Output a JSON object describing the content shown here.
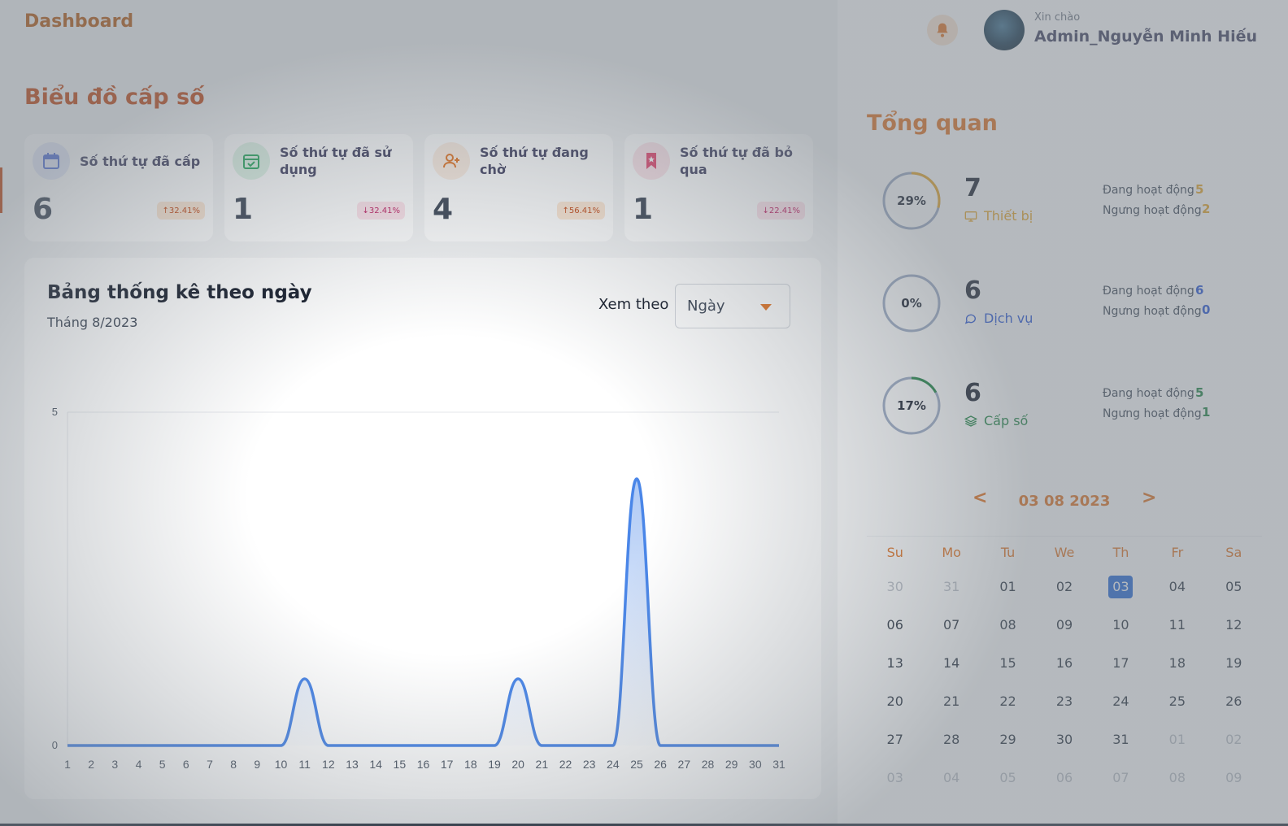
{
  "header": {
    "title": "Dashboard",
    "greeting": "Xin chào",
    "username": "Admin_Nguyễn Minh Hiếu"
  },
  "section_title": "Biểu đồ cấp số",
  "stats": [
    {
      "label": "Số thứ tự đã cấp",
      "value": "6",
      "badge": "↑32.41%",
      "trend": "up",
      "icon": "calendar-icon",
      "color": "#4f6fd8"
    },
    {
      "label": "Số thứ tự đã sử dụng",
      "value": "1",
      "badge": "↓32.41%",
      "trend": "down",
      "icon": "calendar-check-icon",
      "color": "#22a559"
    },
    {
      "label": "Số thứ tự đang chờ",
      "value": "4",
      "badge": "↑56.41%",
      "trend": "up",
      "icon": "user-add-icon",
      "color": "#e26f1b"
    },
    {
      "label": "Số thứ tự đã bỏ qua",
      "value": "1",
      "badge": "↓22.41%",
      "trend": "down",
      "icon": "bookmark-icon",
      "color": "#e2416a"
    }
  ],
  "chart_card": {
    "title": "Bảng thống kê theo ngày",
    "subtitle": "Tháng 8/2023",
    "view_label": "Xem theo",
    "view_value": "Ngày"
  },
  "chart_data": {
    "type": "area",
    "x": [
      "1",
      "2",
      "3",
      "4",
      "5",
      "6",
      "7",
      "8",
      "9",
      "10",
      "11",
      "12",
      "13",
      "14",
      "15",
      "16",
      "17",
      "18",
      "19",
      "20",
      "21",
      "22",
      "23",
      "24",
      "25",
      "26",
      "27",
      "28",
      "29",
      "30",
      "31"
    ],
    "series": [
      {
        "values": [
          0,
          0,
          0,
          0,
          0,
          0,
          0,
          0,
          0,
          0,
          1,
          0,
          0,
          0,
          0,
          0,
          0,
          0,
          0,
          1,
          0,
          0,
          0,
          0,
          4,
          0,
          0,
          0,
          0,
          0,
          0
        ]
      }
    ],
    "yticks": [
      "0",
      "5"
    ],
    "ylim": [
      0,
      5
    ],
    "color": "#4a86e8"
  },
  "overview": {
    "title": "Tổng quan",
    "active_label": "Đang hoạt động",
    "inactive_label": "Ngưng hoạt động",
    "items": [
      {
        "percent": "29%",
        "fraction": 0.29,
        "count": "7",
        "name": "Thiết bị",
        "icon": "monitor-icon",
        "active": "5",
        "inactive": "2",
        "color": "#e8a320"
      },
      {
        "percent": "0%",
        "fraction": 0.0,
        "count": "6",
        "name": "Dịch vụ",
        "icon": "chat-icon",
        "active": "6",
        "inactive": "0",
        "color": "#1d4ed8"
      },
      {
        "percent": "17%",
        "fraction": 0.17,
        "count": "6",
        "name": "Cấp số",
        "icon": "layers-icon",
        "active": "5",
        "inactive": "1",
        "color": "#16803c"
      }
    ]
  },
  "calendar": {
    "prev": "<",
    "next": ">",
    "title": "03 08 2023",
    "weekdays": [
      "Su",
      "Mo",
      "Tu",
      "We",
      "Th",
      "Fr",
      "Sa"
    ],
    "days": [
      "30",
      "31",
      "01",
      "02",
      "03",
      "04",
      "05",
      "06",
      "07",
      "08",
      "09",
      "10",
      "11",
      "12",
      "13",
      "14",
      "15",
      "16",
      "17",
      "18",
      "19",
      "20",
      "21",
      "22",
      "23",
      "24",
      "25",
      "26",
      "27",
      "28",
      "29",
      "30",
      "31",
      "01",
      "02",
      "03",
      "04",
      "05",
      "06",
      "07",
      "08",
      "09"
    ],
    "muted_leading": 2,
    "muted_trailing_from": 33,
    "selected_index": 4
  }
}
